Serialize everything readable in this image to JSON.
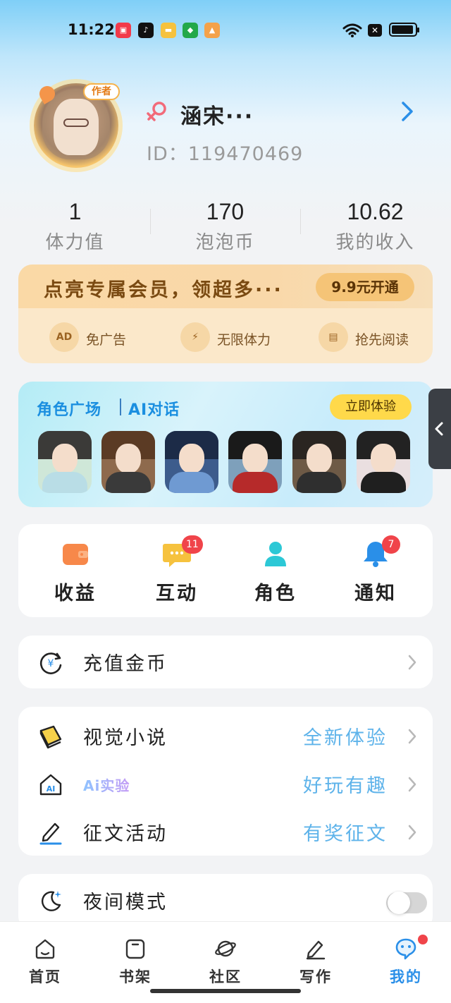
{
  "status_bar": {
    "time": "11:22",
    "app_icons": [
      "red-app-icon",
      "tiktok-icon",
      "yellow-app-icon",
      "green-app-icon",
      "photos-icon"
    ],
    "x_badge": "✕"
  },
  "profile": {
    "author_badge": "作者",
    "username": "涵宋···",
    "user_id": "ID：119470469"
  },
  "stats": [
    {
      "value": "1",
      "label": "体力值"
    },
    {
      "value": "170",
      "label": "泡泡币"
    },
    {
      "value": "10.62",
      "label": "我的收入"
    }
  ],
  "vip": {
    "title": "点亮专属会员，领超多···",
    "button": "9.9元开通",
    "benefits": [
      {
        "icon": "AD",
        "label": "免广告"
      },
      {
        "icon": "⚡",
        "label": "无限体力"
      },
      {
        "icon": "▤",
        "label": "抢先阅读"
      }
    ]
  },
  "role_banner": {
    "title_left": "角色广场",
    "title_right": "AI对话",
    "button": "立即体验"
  },
  "quick_actions": [
    {
      "label": "收益",
      "icon": "wallet-icon",
      "badge": ""
    },
    {
      "label": "互动",
      "icon": "chat-bubble-icon",
      "badge": "11"
    },
    {
      "label": "角色",
      "icon": "person-icon",
      "badge": ""
    },
    {
      "label": "通知",
      "icon": "bell-icon",
      "badge": "7"
    }
  ],
  "recharge": {
    "label": "充值金币"
  },
  "features": [
    {
      "label": "视觉小说",
      "value": "全新体验"
    },
    {
      "label": "Ai实验",
      "value": "好玩有趣"
    },
    {
      "label": "征文活动",
      "value": "有奖征文"
    }
  ],
  "night_mode": {
    "label": "夜间模式",
    "enabled": false
  },
  "bottom_nav": [
    {
      "label": "首页"
    },
    {
      "label": "书架"
    },
    {
      "label": "社区"
    },
    {
      "label": "写作"
    },
    {
      "label": "我的"
    }
  ],
  "colors": {
    "accent": "#2a8fe8",
    "badge": "#f0444a",
    "vip_bg": "#fbe8ca",
    "link_value": "#5eb3ea"
  }
}
